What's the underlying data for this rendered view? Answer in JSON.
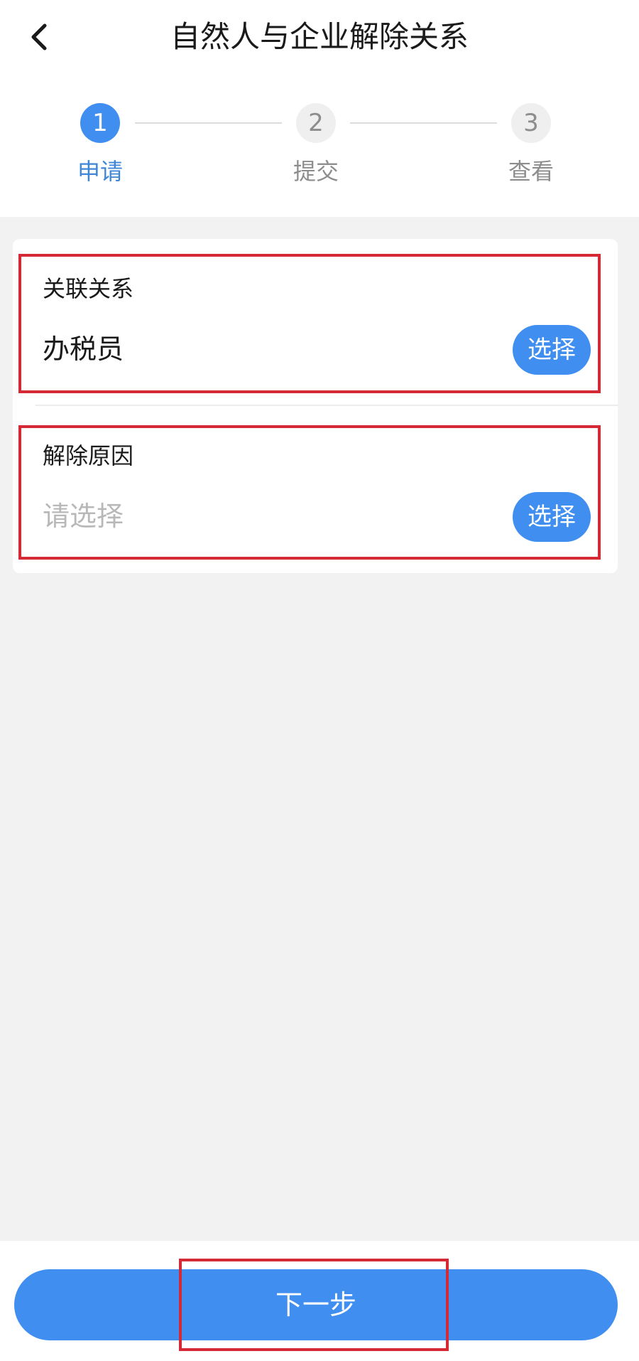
{
  "header": {
    "title": "自然人与企业解除关系",
    "back_icon": "chevron-left-icon"
  },
  "stepper": {
    "steps": [
      {
        "number": "1",
        "label": "申请",
        "state": "active"
      },
      {
        "number": "2",
        "label": "提交",
        "state": "inactive"
      },
      {
        "number": "3",
        "label": "查看",
        "state": "inactive"
      }
    ]
  },
  "form": {
    "relation": {
      "label": "关联关系",
      "value": "办税员",
      "button_label": "选择"
    },
    "reason": {
      "label": "解除原因",
      "placeholder": "请选择",
      "button_label": "选择"
    }
  },
  "footer": {
    "next_label": "下一步"
  },
  "colors": {
    "accent": "#3f8ef0",
    "highlight_box": "#d52a35",
    "background": "#f2f2f2"
  }
}
